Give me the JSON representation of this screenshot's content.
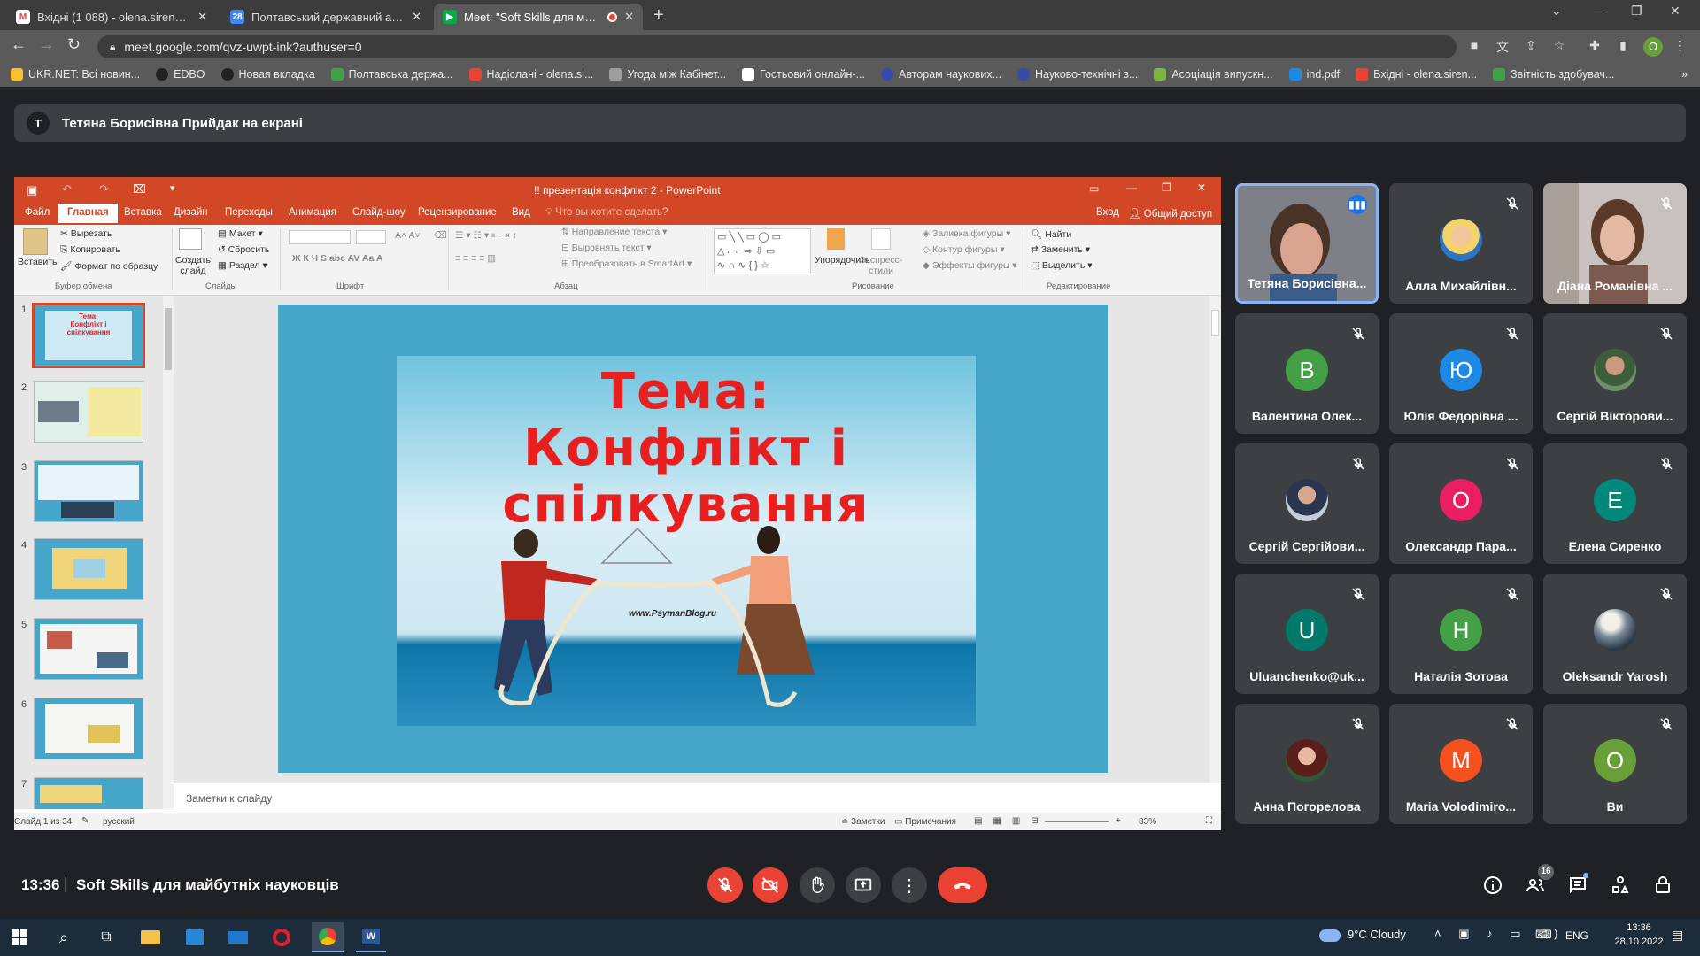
{
  "browser": {
    "tabs": [
      {
        "title": "Вхідні (1 088) - olena.sirenko@p",
        "icon": "gmail-icon"
      },
      {
        "title": "Полтавський державний аграр",
        "icon": "calendar-icon"
      },
      {
        "title": "Meet: \"Soft Skills для майбу",
        "icon": "meet-icon",
        "recording": true
      }
    ],
    "new_tab": "+",
    "url": "meet.google.com/qvz-uwpt-ink?authuser=0",
    "profile_initial": "O",
    "bookmarks": [
      "UKR.NET: Всі новин...",
      "EDBO",
      "Новая вкладка",
      "Полтавська держа...",
      "Надіслані - olena.si...",
      "Угода між Кабінет...",
      "Гостьовий онлайн-...",
      "Авторам наукових...",
      "Науково-технічні з...",
      "Асоціація випускн...",
      "ind.pdf",
      "Вхідні - olena.siren...",
      "Звітність здобувач..."
    ]
  },
  "meet": {
    "presenter_initial": "Т",
    "presenting_banner": "Тетяна Борисівна Прийдак на екрані",
    "time": "13:36",
    "separator": "|",
    "meeting_title": "Soft Skills для майбутніх науковців",
    "participants_count": "16",
    "participants": [
      {
        "name": "Тетяна Борисівна...",
        "type": "photo",
        "speaking": true
      },
      {
        "name": "Алла Михайлівн...",
        "type": "photo"
      },
      {
        "name": "Діана Романівна ...",
        "type": "photo"
      },
      {
        "name": "Валентина Олек...",
        "initial": "В",
        "color": "#43a047"
      },
      {
        "name": "Юлія Федорівна ...",
        "initial": "Ю",
        "color": "#1e88e5"
      },
      {
        "name": "Сергій Вікторови...",
        "type": "photo"
      },
      {
        "name": "Сергій Сергійови...",
        "type": "photo"
      },
      {
        "name": "Олександр Пара...",
        "initial": "О",
        "color": "#e91e63"
      },
      {
        "name": "Елена Сиренко",
        "initial": "Е",
        "color": "#00897b"
      },
      {
        "name": "Uluanchenko@uk...",
        "initial": "U",
        "color": "#00796b"
      },
      {
        "name": "Наталія Зотова",
        "initial": "Н",
        "color": "#43a047"
      },
      {
        "name": "Oleksandr Yarosh",
        "type": "photo"
      },
      {
        "name": "Анна Погорелова",
        "type": "photo"
      },
      {
        "name": "Maria Volodimiro...",
        "initial": "M",
        "color": "#f4511e"
      },
      {
        "name": "Ви",
        "initial": "О",
        "color": "#689f38"
      }
    ]
  },
  "powerpoint": {
    "title": "!! презентація конфлікт 2  -  PowerPoint",
    "tabs": [
      "Файл",
      "Главная",
      "Вставка",
      "Дизайн",
      "Переходы",
      "Анимация",
      "Слайд-шоу",
      "Рецензирование",
      "Вид"
    ],
    "tell_me": "Что вы хотите сделать?",
    "login": "Вход",
    "share": "Общий доступ",
    "ribbon": {
      "paste": "Вставить",
      "cut": "Вырезать",
      "copy": "Копировать",
      "format_painter": "Формат по образцу",
      "new_slide": "Создать слайд",
      "layout": "Макет",
      "reset": "Сбросить",
      "section": "Раздел",
      "text_direction": "Направление текста",
      "align_text": "Выровнять текст",
      "smartart": "Преобразовать в SmartArt",
      "arrange": "Упорядочить",
      "quick_styles": "Экспресс-стили",
      "shape_fill": "Заливка фигуры",
      "shape_outline": "Контур фигуры",
      "shape_effects": "Эффекты фигуры",
      "find": "Найти",
      "replace": "Заменить",
      "select": "Выделить",
      "groups": [
        "Буфер обмена",
        "Слайды",
        "Шрифт",
        "Абзац",
        "Рисование",
        "Редактирование"
      ]
    },
    "slide_numbers": [
      "1",
      "2",
      "3",
      "4",
      "5",
      "6",
      "7"
    ],
    "slide_title_line1": "Тема:",
    "slide_title_line2": "Конфлікт і",
    "slide_title_line3": "спілкування",
    "slide_watermark": "www.PsymanBlog.ru",
    "notes_placeholder": "Заметки к слайду",
    "status": {
      "slide_count": "Слайд 1 из 34",
      "language": "русский",
      "notes": "Заметки",
      "comments": "Примечания",
      "zoom": "83%"
    }
  },
  "taskbar": {
    "weather": "9°C  Cloudy",
    "lang": "ENG",
    "time": "13:36",
    "date": "28.10.2022"
  }
}
